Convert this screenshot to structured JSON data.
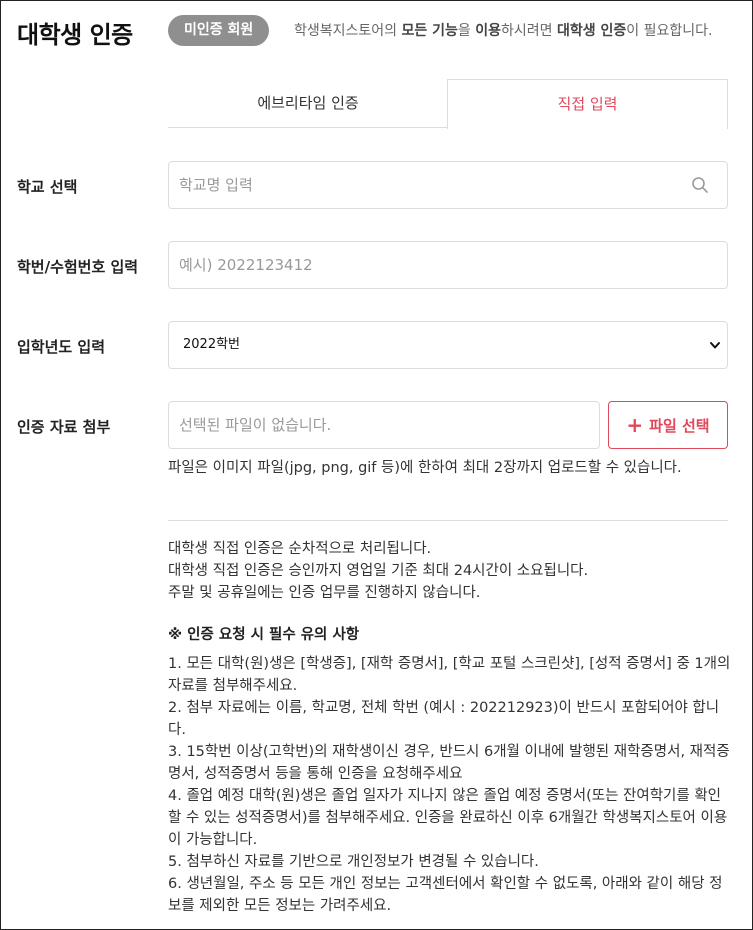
{
  "header": {
    "title": "대학생 인증",
    "badge": "미인증 회원",
    "notice_parts": [
      "학생복지스토어의 ",
      "모든 기능",
      "을 ",
      "이용",
      "하시려면 ",
      "대학생 인증",
      "이 필요합니다."
    ]
  },
  "tabs": [
    {
      "label": "에브리타임 인증",
      "active": false
    },
    {
      "label": "직접 입력",
      "active": true
    }
  ],
  "form": {
    "school": {
      "label": "학교 선택",
      "placeholder": "학교명 입력"
    },
    "student_id": {
      "label": "학번/수험번호 입력",
      "placeholder": "예시) 2022123412"
    },
    "admission_year": {
      "label": "입학년도 입력",
      "value": "2022학번"
    },
    "attachment": {
      "label": "인증 자료 첨부",
      "placeholder": "선택된 파일이 없습니다.",
      "button": "파일 선택",
      "helper": "파일은 이미지 파일(jpg, png, gif 등)에 한하여 최대 2장까지 업로드할 수 있습니다."
    }
  },
  "info_lines": [
    "대학생 직접 인증은 순차적으로 처리됩니다.",
    "대학생 직접 인증은 승인까지 영업일 기준 최대 24시간이 소요됩니다.",
    "주말 및 공휴일에는 인증 업무를 진행하지 않습니다."
  ],
  "warning": {
    "title": "※ 인증 요청 시 필수 유의 사항",
    "items": [
      "1. 모든 대학(원)생은 [학생증], [재학 증명서], [학교 포털 스크린샷], [성적 증명서] 중 1개의 자료를 첨부해주세요.",
      "2. 첨부 자료에는 이름, 학교명, 전체 학번 (예시 : 202212923)이 반드시 포함되어야 합니다.",
      "3. 15학번 이상(고학번)의 재학생이신 경우, 반드시 6개월 이내에 발행된 재학증명서, 재적증명서, 성적증명서 등을 통해 인증을 요청해주세요",
      "4. 졸업 예정 대학(원)생은 졸업 일자가 지나지 않은 졸업 예정 증명서(또는 잔여학기를 확인할 수 있는 성적증명서)를 첨부해주세요. 인증을 완료하신 이후 6개월간 학생복지스토어 이용이 가능합니다.",
      "5. 첨부하신 자료를 기반으로 개인정보가 변경될 수 있습니다.",
      "6. 생년월일, 주소 등 모든 개인 정보는 고객센터에서 확인할 수 없도록, 아래와 같이 해당 정보를 제외한 모든 정보는 가려주세요."
    ]
  },
  "colors": {
    "accent": "#e0485b",
    "badge": "#8f8f8f",
    "border": "#dddddd"
  }
}
